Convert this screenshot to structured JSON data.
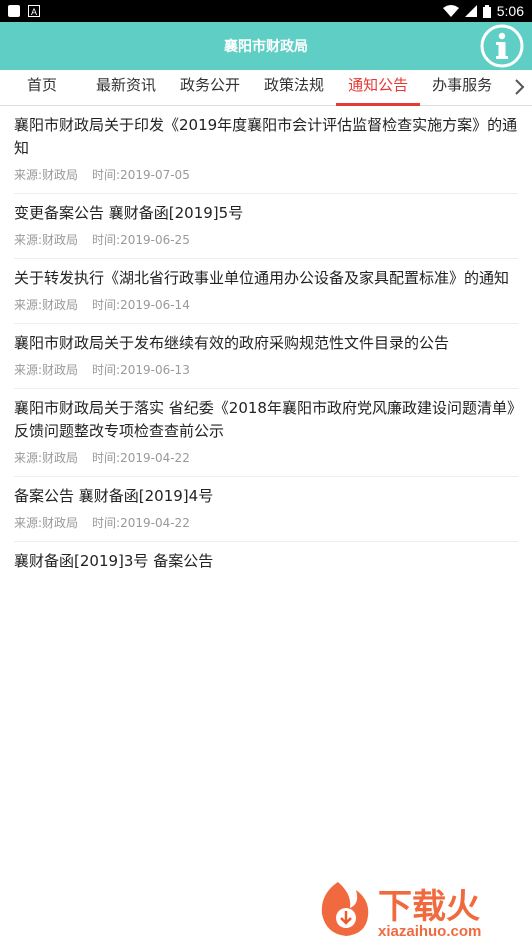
{
  "status_bar": {
    "time": "5:06"
  },
  "header": {
    "title": "襄阳市财政局"
  },
  "tabs": [
    {
      "label": "首页"
    },
    {
      "label": "最新资讯"
    },
    {
      "label": "政务公开"
    },
    {
      "label": "政策法规"
    },
    {
      "label": "通知公告"
    },
    {
      "label": "办事服务"
    }
  ],
  "active_tab": "通知公告",
  "items": [
    {
      "title": "襄阳市财政局关于印发《2019年度襄阳市会计评估监督检查实施方案》的通知",
      "source": "来源:财政局",
      "time": "时间:2019-07-05"
    },
    {
      "title": "变更备案公告 襄财备函[2019]5号",
      "source": "来源:财政局",
      "time": "时间:2019-06-25"
    },
    {
      "title": "关于转发执行《湖北省行政事业单位通用办公设备及家具配置标准》的通知",
      "source": "来源:财政局",
      "time": "时间:2019-06-14"
    },
    {
      "title": "襄阳市财政局关于发布继续有效的政府采购规范性文件目录的公告",
      "source": "来源:财政局",
      "time": "时间:2019-06-13"
    },
    {
      "title": "襄阳市财政局关于落实 省纪委《2018年襄阳市政府党风廉政建设问题清单》反馈问题整改专项检查查前公示",
      "source": "来源:财政局",
      "time": "时间:2019-04-22"
    },
    {
      "title": "备案公告 襄财备函[2019]4号",
      "source": "来源:财政局",
      "time": "时间:2019-04-22"
    },
    {
      "title": "襄财备函[2019]3号 备案公告"
    }
  ],
  "watermark": {
    "text_cn": "下载火",
    "text_url": "xiazaihuo.com"
  },
  "colors": {
    "header_bg": "#5fcfc6",
    "active_tab": "#e53935",
    "meta_text": "#999999"
  }
}
